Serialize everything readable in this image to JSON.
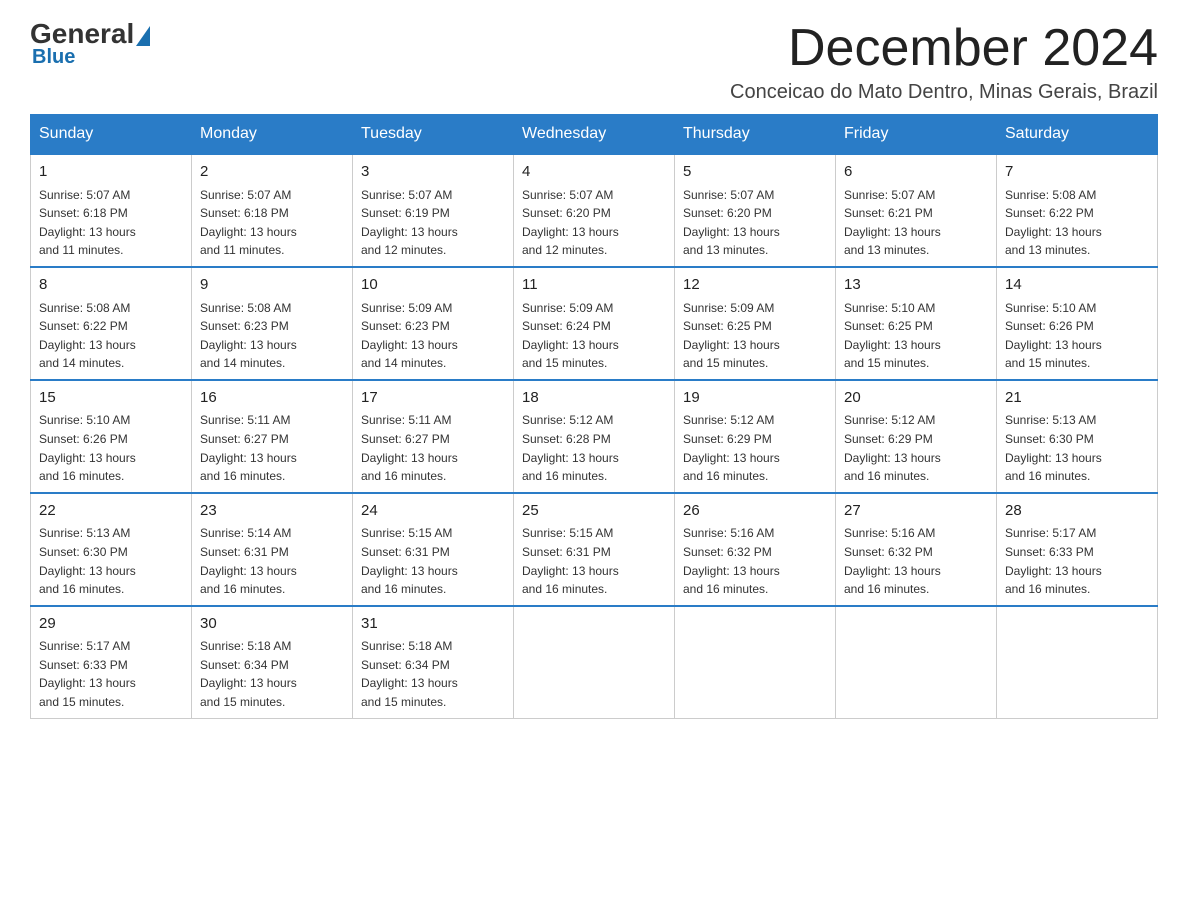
{
  "logo": {
    "general": "General",
    "blue": "Blue"
  },
  "header": {
    "title": "December 2024",
    "location": "Conceicao do Mato Dentro, Minas Gerais, Brazil"
  },
  "days_of_week": [
    "Sunday",
    "Monday",
    "Tuesday",
    "Wednesday",
    "Thursday",
    "Friday",
    "Saturday"
  ],
  "weeks": [
    [
      {
        "day": "1",
        "sunrise": "5:07 AM",
        "sunset": "6:18 PM",
        "daylight": "13 hours and 11 minutes."
      },
      {
        "day": "2",
        "sunrise": "5:07 AM",
        "sunset": "6:18 PM",
        "daylight": "13 hours and 11 minutes."
      },
      {
        "day": "3",
        "sunrise": "5:07 AM",
        "sunset": "6:19 PM",
        "daylight": "13 hours and 12 minutes."
      },
      {
        "day": "4",
        "sunrise": "5:07 AM",
        "sunset": "6:20 PM",
        "daylight": "13 hours and 12 minutes."
      },
      {
        "day": "5",
        "sunrise": "5:07 AM",
        "sunset": "6:20 PM",
        "daylight": "13 hours and 13 minutes."
      },
      {
        "day": "6",
        "sunrise": "5:07 AM",
        "sunset": "6:21 PM",
        "daylight": "13 hours and 13 minutes."
      },
      {
        "day": "7",
        "sunrise": "5:08 AM",
        "sunset": "6:22 PM",
        "daylight": "13 hours and 13 minutes."
      }
    ],
    [
      {
        "day": "8",
        "sunrise": "5:08 AM",
        "sunset": "6:22 PM",
        "daylight": "13 hours and 14 minutes."
      },
      {
        "day": "9",
        "sunrise": "5:08 AM",
        "sunset": "6:23 PM",
        "daylight": "13 hours and 14 minutes."
      },
      {
        "day": "10",
        "sunrise": "5:09 AM",
        "sunset": "6:23 PM",
        "daylight": "13 hours and 14 minutes."
      },
      {
        "day": "11",
        "sunrise": "5:09 AM",
        "sunset": "6:24 PM",
        "daylight": "13 hours and 15 minutes."
      },
      {
        "day": "12",
        "sunrise": "5:09 AM",
        "sunset": "6:25 PM",
        "daylight": "13 hours and 15 minutes."
      },
      {
        "day": "13",
        "sunrise": "5:10 AM",
        "sunset": "6:25 PM",
        "daylight": "13 hours and 15 minutes."
      },
      {
        "day": "14",
        "sunrise": "5:10 AM",
        "sunset": "6:26 PM",
        "daylight": "13 hours and 15 minutes."
      }
    ],
    [
      {
        "day": "15",
        "sunrise": "5:10 AM",
        "sunset": "6:26 PM",
        "daylight": "13 hours and 16 minutes."
      },
      {
        "day": "16",
        "sunrise": "5:11 AM",
        "sunset": "6:27 PM",
        "daylight": "13 hours and 16 minutes."
      },
      {
        "day": "17",
        "sunrise": "5:11 AM",
        "sunset": "6:27 PM",
        "daylight": "13 hours and 16 minutes."
      },
      {
        "day": "18",
        "sunrise": "5:12 AM",
        "sunset": "6:28 PM",
        "daylight": "13 hours and 16 minutes."
      },
      {
        "day": "19",
        "sunrise": "5:12 AM",
        "sunset": "6:29 PM",
        "daylight": "13 hours and 16 minutes."
      },
      {
        "day": "20",
        "sunrise": "5:12 AM",
        "sunset": "6:29 PM",
        "daylight": "13 hours and 16 minutes."
      },
      {
        "day": "21",
        "sunrise": "5:13 AM",
        "sunset": "6:30 PM",
        "daylight": "13 hours and 16 minutes."
      }
    ],
    [
      {
        "day": "22",
        "sunrise": "5:13 AM",
        "sunset": "6:30 PM",
        "daylight": "13 hours and 16 minutes."
      },
      {
        "day": "23",
        "sunrise": "5:14 AM",
        "sunset": "6:31 PM",
        "daylight": "13 hours and 16 minutes."
      },
      {
        "day": "24",
        "sunrise": "5:15 AM",
        "sunset": "6:31 PM",
        "daylight": "13 hours and 16 minutes."
      },
      {
        "day": "25",
        "sunrise": "5:15 AM",
        "sunset": "6:31 PM",
        "daylight": "13 hours and 16 minutes."
      },
      {
        "day": "26",
        "sunrise": "5:16 AM",
        "sunset": "6:32 PM",
        "daylight": "13 hours and 16 minutes."
      },
      {
        "day": "27",
        "sunrise": "5:16 AM",
        "sunset": "6:32 PM",
        "daylight": "13 hours and 16 minutes."
      },
      {
        "day": "28",
        "sunrise": "5:17 AM",
        "sunset": "6:33 PM",
        "daylight": "13 hours and 16 minutes."
      }
    ],
    [
      {
        "day": "29",
        "sunrise": "5:17 AM",
        "sunset": "6:33 PM",
        "daylight": "13 hours and 15 minutes."
      },
      {
        "day": "30",
        "sunrise": "5:18 AM",
        "sunset": "6:34 PM",
        "daylight": "13 hours and 15 minutes."
      },
      {
        "day": "31",
        "sunrise": "5:18 AM",
        "sunset": "6:34 PM",
        "daylight": "13 hours and 15 minutes."
      },
      null,
      null,
      null,
      null
    ]
  ],
  "labels": {
    "sunrise": "Sunrise:",
    "sunset": "Sunset:",
    "daylight": "Daylight:"
  }
}
